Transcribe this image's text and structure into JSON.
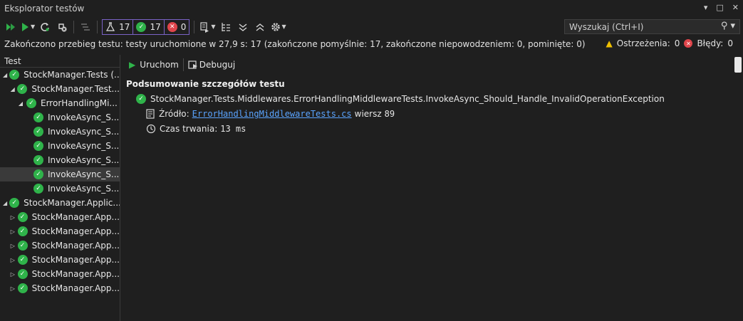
{
  "window": {
    "title": "Eksplorator testów",
    "controls": [
      "▾",
      "□",
      "✕"
    ]
  },
  "toolbar": {
    "total_count": "17",
    "passed_count": "17",
    "failed_count": "0"
  },
  "search": {
    "placeholder": "Wyszukaj (Ctrl+I)",
    "icon": "search-icon"
  },
  "status": {
    "summary": "Zakończono przebieg testu: testy uruchomione w 27,9 s: 17 (zakończone pomyślnie: 17, zakończone niepowodzeniem: 0, pominięte: 0)",
    "warnings_label": "Ostrzeżenia:",
    "warnings_count": "0",
    "errors_label": "Błędy:",
    "errors_count": "0"
  },
  "tree": {
    "header": "Test",
    "rows": [
      {
        "label": "StockManager.Tests (...",
        "level": 0,
        "expanded": true,
        "selected": false
      },
      {
        "label": "StockManager.Test...",
        "level": 1,
        "expanded": true,
        "selected": false
      },
      {
        "label": "ErrorHandlingMi...",
        "level": 2,
        "expanded": true,
        "selected": false
      },
      {
        "label": "InvokeAsync_S...",
        "level": 3,
        "expanded": null,
        "selected": false
      },
      {
        "label": "InvokeAsync_S...",
        "level": 3,
        "expanded": null,
        "selected": false
      },
      {
        "label": "InvokeAsync_S...",
        "level": 3,
        "expanded": null,
        "selected": false
      },
      {
        "label": "InvokeAsync_S...",
        "level": 3,
        "expanded": null,
        "selected": false
      },
      {
        "label": "InvokeAsync_S...",
        "level": 3,
        "expanded": null,
        "selected": true
      },
      {
        "label": "InvokeAsync_S...",
        "level": 3,
        "expanded": null,
        "selected": false
      },
      {
        "label": "StockManager.Applic...",
        "level": 0,
        "expanded": true,
        "selected": false
      },
      {
        "label": "StockManager.App...",
        "level": 1,
        "expanded": false,
        "selected": false
      },
      {
        "label": "StockManager.App...",
        "level": 1,
        "expanded": false,
        "selected": false
      },
      {
        "label": "StockManager.App...",
        "level": 1,
        "expanded": false,
        "selected": false
      },
      {
        "label": "StockManager.App...",
        "level": 1,
        "expanded": false,
        "selected": false
      },
      {
        "label": "StockManager.App...",
        "level": 1,
        "expanded": false,
        "selected": false
      },
      {
        "label": "StockManager.App...",
        "level": 1,
        "expanded": false,
        "selected": false
      }
    ]
  },
  "details": {
    "run_label": "Uruchom",
    "debug_label": "Debuguj",
    "summary_title": "Podsumowanie szczegółów testu",
    "test_name": "StockManager.Tests.Middlewares.ErrorHandlingMiddlewareTests.InvokeAsync_Should_Handle_InvalidOperationException",
    "source_label": "Źródło:",
    "source_file": "ErrorHandlingMiddlewareTests.cs",
    "line_label": "wiersz",
    "line_number": "89",
    "duration_label": "Czas trwania:",
    "duration_value": "13 ms"
  },
  "colors": {
    "background": "#1f1f1f",
    "pass_green": "#2fb34a",
    "fail_red": "#e0454b",
    "accent_purple": "#7a62c6",
    "link_blue": "#5aa4ff"
  }
}
